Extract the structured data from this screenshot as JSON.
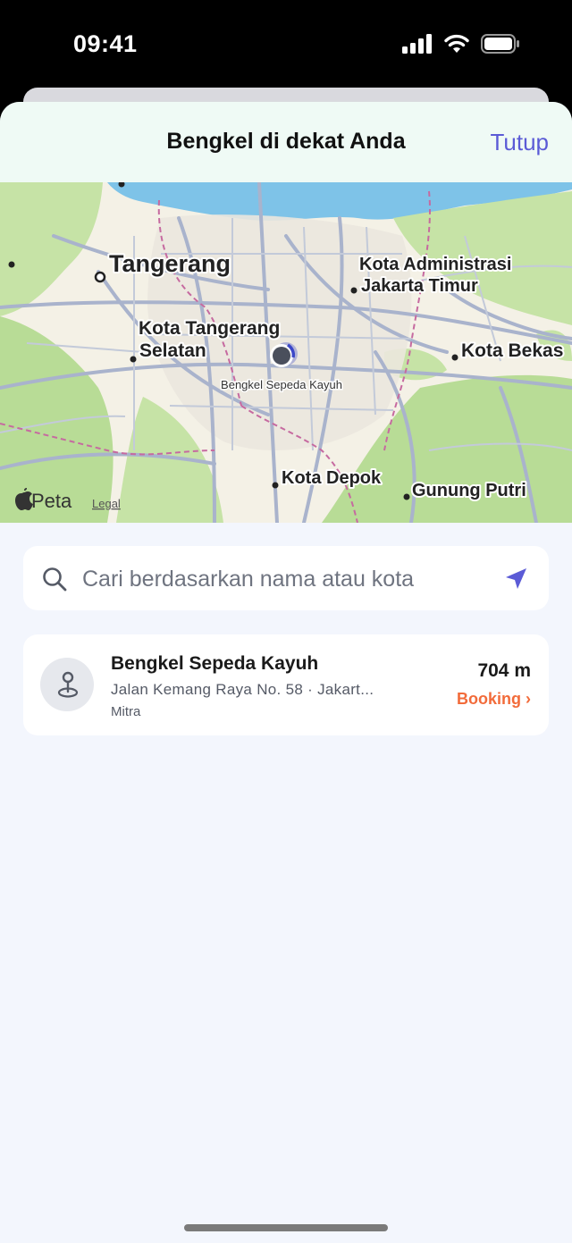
{
  "status_bar": {
    "time": "09:41",
    "icons": [
      "cellular-signal-icon",
      "wifi-icon",
      "battery-icon"
    ]
  },
  "sheet": {
    "title": "Bengkel di dekat Anda",
    "close_label": "Tutup"
  },
  "map": {
    "labels": {
      "tangerang": "Tangerang",
      "jakarta_timur_1": "Kota Administrasi",
      "jakarta_timur_2": "Jakarta Timur",
      "tangsel_1": "Kota Tangerang",
      "tangsel_2": "Selatan",
      "bekasi": "Kota Bekas",
      "depok": "Kota Depok",
      "gunung_putri": "Gunung Putri",
      "marker": "Bengkel Sepeda Kayuh",
      "attribution": "Peta",
      "legal": "Legal"
    }
  },
  "search": {
    "placeholder": "Cari berdasarkan nama atau kota",
    "value": ""
  },
  "results": [
    {
      "name": "Bengkel Sepeda Kayuh",
      "address": "Jalan Kemang Raya No. 58 · Jakart...",
      "type": "Mitra",
      "distance": "704 m",
      "action": "Booking ›"
    }
  ],
  "colors": {
    "accent": "#5b5bd6",
    "booking": "#f26b3a",
    "sheet_bg": "#f3f6fd",
    "header_bg": "#effaf5"
  }
}
